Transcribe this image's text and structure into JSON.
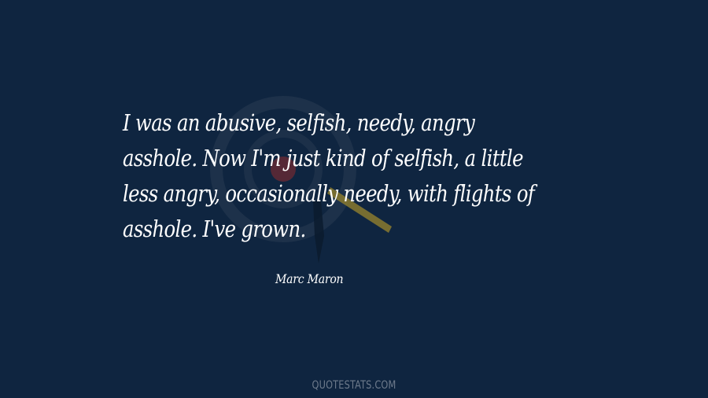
{
  "quote": {
    "text": "I was an abusive, selfish, needy, angry asshole. Now I'm just kind of selfish, a little less angry, occasionally needy, with flights of asshole. I've grown.",
    "author": "Marc Maron"
  },
  "footer": {
    "brand": "QUOTESTATS.COM"
  },
  "colors": {
    "background": "#0f2540",
    "text": "#ffffff",
    "brand": "#6e7b8c"
  }
}
